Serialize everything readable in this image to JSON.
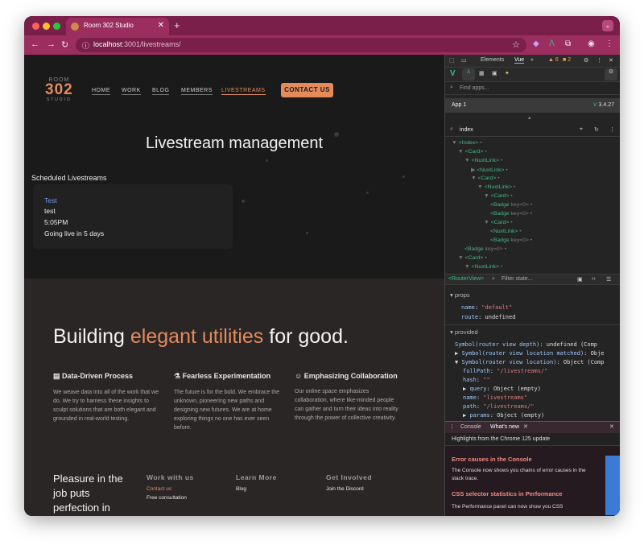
{
  "browser": {
    "tab_title": "Room 302 Studio",
    "new_tab_symbol": "+",
    "url_host": "localhost",
    "url_rest": ":3001/livestreams/",
    "accent": "#9b2e5f"
  },
  "site": {
    "logo": {
      "top": "ROOM",
      "main": "302",
      "bottom": "STUDIO"
    },
    "nav": [
      "HOME",
      "WORK",
      "BLOG",
      "MEMBERS",
      "LIVESTREAMS"
    ],
    "nav_active": "LIVESTREAMS",
    "contact_label": "CONTACT US",
    "hero_title": "Livestream management",
    "scheduled_title": "Scheduled Livestreams",
    "card": {
      "title": "Test",
      "description": "test",
      "time": "5:05PM",
      "status": "Going live in 5 days"
    },
    "headline": {
      "pre": "Building ",
      "accent": "elegant utilities",
      "post": " for good."
    },
    "features": [
      {
        "icon": "server-icon",
        "title": "Data-Driven Process",
        "text": "We weave data into all of the work that we do. We try to harness these insights to sculpt solutions that are both elegant and grounded in real-world testing."
      },
      {
        "icon": "beaker-icon",
        "title": "Fearless Experimentation",
        "text": "The future is for the bold. We embrace the unknown, pioneering new paths and designing new futures. We are at home exploring things no one has ever seen before."
      },
      {
        "icon": "smile-icon",
        "title": "Emphasizing Collaboration",
        "text": "Our online space emphasizes collaboration, where like-minded people can gather and turn their ideas into reality through the power of collective creativity."
      }
    ],
    "pleasure": "Pleasure in the job puts perfection in",
    "footer": [
      {
        "heading": "Work with us",
        "links": [
          "Contact us",
          "Free consultation"
        ]
      },
      {
        "heading": "Learn More",
        "links": [
          "Blog"
        ]
      },
      {
        "heading": "Get Involved",
        "links": [
          "Join the Discord"
        ]
      }
    ],
    "accent": "#e48a5b"
  },
  "devtools": {
    "tabs": [
      "Elements",
      "Vue"
    ],
    "more": "»",
    "warnings": "6",
    "errors": "2",
    "find_apps_placeholder": "Find apps...",
    "app_name": "App 1",
    "vue_version": "3.4.27",
    "component_search": "index",
    "tree": [
      {
        "depth": 0,
        "arrow": "▼",
        "name": "<Index>",
        "extra": ""
      },
      {
        "depth": 1,
        "arrow": "▼",
        "name": "<Card>",
        "extra": ""
      },
      {
        "depth": 2,
        "arrow": "▼",
        "name": "<NuxtLink>",
        "extra": ""
      },
      {
        "depth": 3,
        "arrow": "▶",
        "name": "<NuxtLink>",
        "extra": ""
      },
      {
        "depth": 3,
        "arrow": "▼",
        "name": "<Card>",
        "extra": ""
      },
      {
        "depth": 4,
        "arrow": "▼",
        "name": "<NuxtLink>",
        "extra": ""
      },
      {
        "depth": 5,
        "arrow": "▼",
        "name": "<Card>",
        "extra": ""
      },
      {
        "depth": 6,
        "arrow": "",
        "name": "<Badge",
        "extra": "key=0>"
      },
      {
        "depth": 6,
        "arrow": "",
        "name": "<Badge",
        "extra": "key=0>"
      },
      {
        "depth": 5,
        "arrow": "▼",
        "name": "<Card>",
        "extra": ""
      },
      {
        "depth": 6,
        "arrow": "",
        "name": "<NuxtLink>",
        "extra": ""
      },
      {
        "depth": 6,
        "arrow": "",
        "name": "<Badge",
        "extra": "key=0>"
      },
      {
        "depth": 2,
        "arrow": "",
        "name": "<Badge",
        "extra": "key=0>"
      },
      {
        "depth": 1,
        "arrow": "▼",
        "name": "<Card>",
        "extra": ""
      },
      {
        "depth": 2,
        "arrow": "▼",
        "name": "<NuxtLink>",
        "extra": ""
      }
    ],
    "router_view": "<RouterView>",
    "filter_placeholder": "Filter state...",
    "props_title": "props",
    "props": [
      {
        "key": "name",
        "value": "\"default\"",
        "type": "str"
      },
      {
        "key": "route",
        "value": "undefined",
        "type": "plain"
      }
    ],
    "provided_title": "provided",
    "provided": [
      {
        "indent": 0,
        "arrow": "",
        "key": "Symbol(router view depth)",
        "value": "undefined (Comp"
      },
      {
        "indent": 0,
        "arrow": "▶",
        "key": "Symbol(router view location matched)",
        "value": "Obje"
      },
      {
        "indent": 0,
        "arrow": "▼",
        "key": "Symbol(router view location)",
        "value": "Object (Comp"
      },
      {
        "indent": 1,
        "arrow": "",
        "key": "fullPath",
        "value": "\"/livestreams/\""
      },
      {
        "indent": 1,
        "arrow": "",
        "key": "hash",
        "value": "\"\""
      },
      {
        "indent": 1,
        "arrow": "▶",
        "key": "query",
        "value": "Object (empty)"
      },
      {
        "indent": 1,
        "arrow": "",
        "key": "name",
        "value": "\"livestreams\""
      },
      {
        "indent": 1,
        "arrow": "",
        "key": "path",
        "value": "\"/livestreams/\""
      },
      {
        "indent": 1,
        "arrow": "▶",
        "key": "params",
        "value": "Object (empty)"
      }
    ],
    "drawer_tabs": [
      "Console",
      "What's new"
    ],
    "drawer_header": "Highlights from the Chrome 125 update",
    "news": [
      {
        "title": "Error causes in the Console",
        "text": "The Console now shows you chains of error causes in the stack trace."
      },
      {
        "title": "CSS selector statistics in Performance",
        "text": "The Performance panel can now show you CSS"
      }
    ]
  }
}
